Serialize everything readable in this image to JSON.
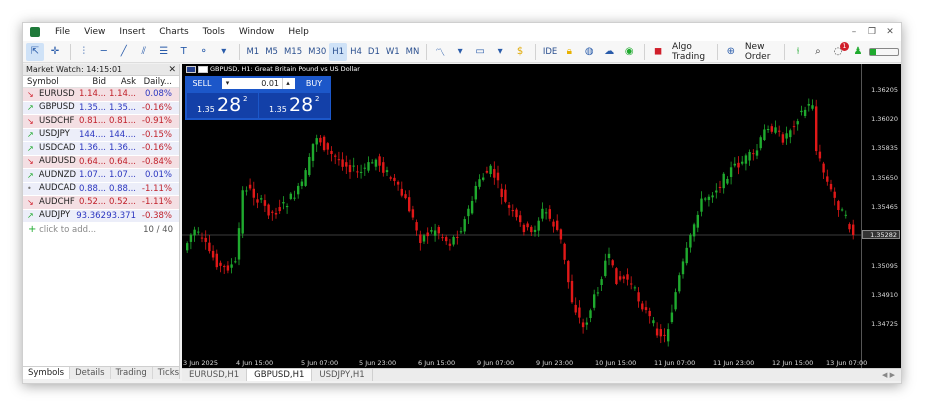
{
  "menubar": {
    "items": [
      "File",
      "View",
      "Insert",
      "Charts",
      "Tools",
      "Window",
      "Help"
    ]
  },
  "toolbar": {
    "timeframes": [
      "M1",
      "M5",
      "M15",
      "M30",
      "H1",
      "H4",
      "D1",
      "W1",
      "MN"
    ],
    "active_timeframe": "H1",
    "ide_label": "IDE",
    "algo_label": "Algo Trading",
    "new_order_label": "New Order",
    "notification_count": "1"
  },
  "market_watch": {
    "title": "Market Watch: 14:15:01",
    "columns": {
      "symbol": "Symbol",
      "bid": "Bid",
      "ask": "Ask",
      "daily": "Daily..."
    },
    "rows": [
      {
        "symbol": "EURUSD",
        "bid": "1.14...",
        "ask": "1.14...",
        "daily": "0.08%",
        "dir": "down",
        "neg": false
      },
      {
        "symbol": "GBPUSD",
        "bid": "1.35...",
        "ask": "1.35...",
        "daily": "-0.16%",
        "dir": "up",
        "neg": true
      },
      {
        "symbol": "USDCHF",
        "bid": "0.81...",
        "ask": "0.81...",
        "daily": "-0.91%",
        "dir": "down",
        "neg": true
      },
      {
        "symbol": "USDJPY",
        "bid": "144....",
        "ask": "144....",
        "daily": "-0.15%",
        "dir": "up",
        "neg": true
      },
      {
        "symbol": "USDCAD",
        "bid": "1.36...",
        "ask": "1.36...",
        "daily": "-0.16%",
        "dir": "up",
        "neg": true
      },
      {
        "symbol": "AUDUSD",
        "bid": "0.64...",
        "ask": "0.64...",
        "daily": "-0.84%",
        "dir": "down",
        "neg": true
      },
      {
        "symbol": "AUDNZD",
        "bid": "1.07...",
        "ask": "1.07...",
        "daily": "0.01%",
        "dir": "up",
        "neg": false
      },
      {
        "symbol": "AUDCAD",
        "bid": "0.88...",
        "ask": "0.88...",
        "daily": "-1.11%",
        "dir": "flat",
        "neg": true
      },
      {
        "symbol": "AUDCHF",
        "bid": "0.52...",
        "ask": "0.52...",
        "daily": "-1.11%",
        "dir": "down",
        "neg": true
      },
      {
        "symbol": "AUDJPY",
        "bid": "93.362",
        "ask": "93.371",
        "daily": "-0.38%",
        "dir": "up",
        "neg": true
      }
    ],
    "add_label": "click to add...",
    "count": "10 / 40",
    "tabs": [
      "Symbols",
      "Details",
      "Trading",
      "Ticks"
    ]
  },
  "chart": {
    "title": "GBPUSD, H1:  Great Britain Pound vs US Dollar",
    "sell_label": "SELL",
    "buy_label": "BUY",
    "lot": "0.01",
    "sell_small": "1.35",
    "sell_big": "28",
    "sell_sup": "2",
    "buy_small": "1.35",
    "buy_big": "28",
    "buy_sup": "2",
    "current_price": "1.35282",
    "price_labels": [
      "1.36205",
      "1.36020",
      "1.35835",
      "1.35650",
      "1.35465",
      "1.35095",
      "1.34910",
      "1.34725"
    ],
    "time_labels": [
      "3 Jun 2025",
      "4 Jun 15:00",
      "5 Jun 07:00",
      "5 Jun 23:00",
      "6 Jun 15:00",
      "9 Jun 07:00",
      "9 Jun 23:00",
      "10 Jun 15:00",
      "11 Jun 07:00",
      "11 Jun 23:00",
      "12 Jun 15:00",
      "13 Jun 07:00"
    ],
    "tabs": [
      "EURUSD,H1",
      "GBPUSD,H1",
      "USDJPY,H1"
    ],
    "active_tab": "GBPUSD,H1"
  },
  "colors": {
    "bull": "#1faa2e",
    "bear": "#e01818",
    "accent": "#1c57c9"
  }
}
